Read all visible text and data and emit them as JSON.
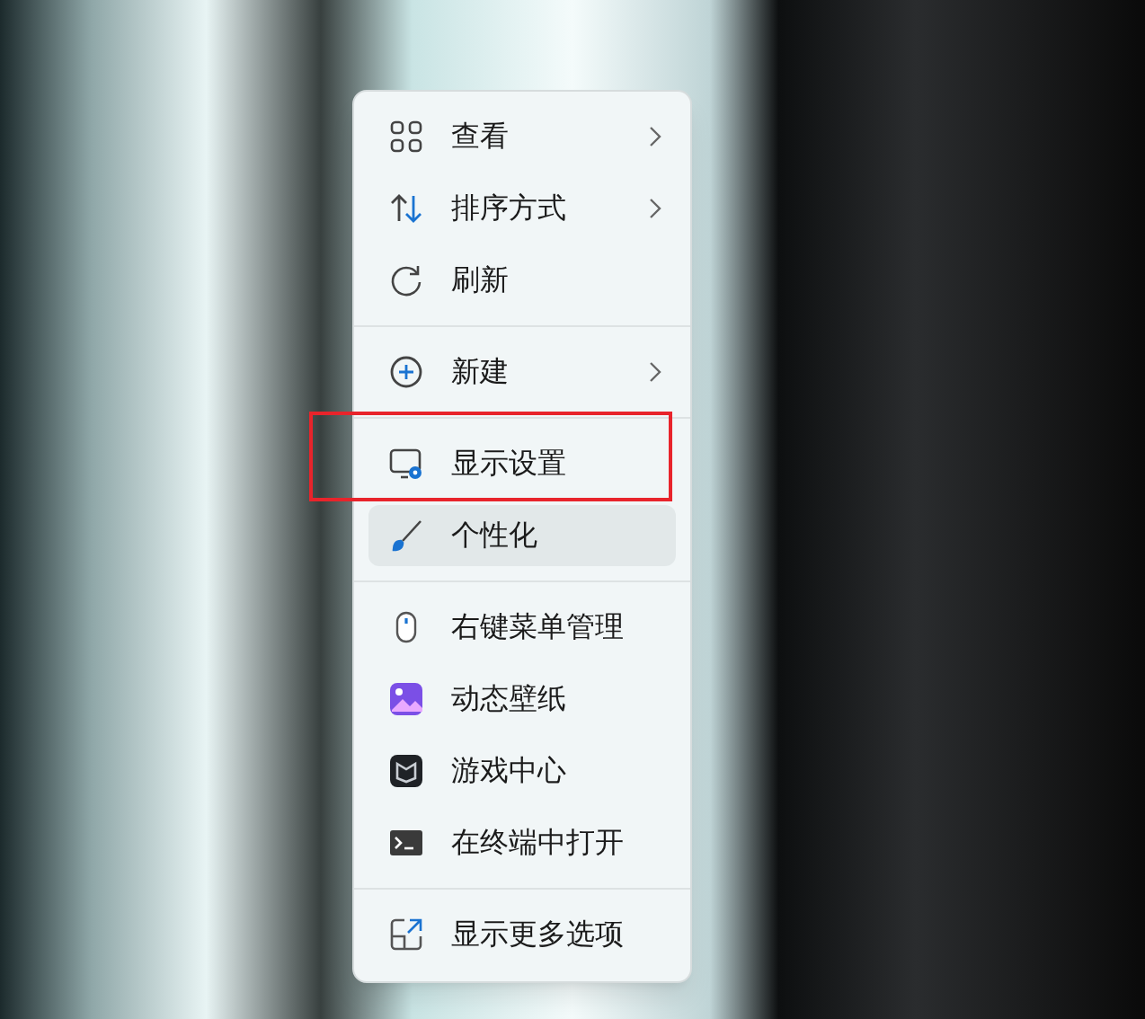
{
  "menu": {
    "sections": [
      {
        "items": [
          {
            "label": "查看",
            "has_submenu": true,
            "selected": false,
            "highlighted": false
          },
          {
            "label": "排序方式",
            "has_submenu": true,
            "selected": false,
            "highlighted": false
          },
          {
            "label": "刷新",
            "has_submenu": false,
            "selected": false,
            "highlighted": false
          }
        ]
      },
      {
        "items": [
          {
            "label": "新建",
            "has_submenu": true,
            "selected": false,
            "highlighted": false
          }
        ]
      },
      {
        "items": [
          {
            "label": "显示设置",
            "has_submenu": false,
            "selected": false,
            "highlighted": true
          },
          {
            "label": "个性化",
            "has_submenu": false,
            "selected": true,
            "highlighted": false
          }
        ]
      },
      {
        "items": [
          {
            "label": "右键菜单管理",
            "has_submenu": false,
            "selected": false,
            "highlighted": false
          },
          {
            "label": "动态壁纸",
            "has_submenu": false,
            "selected": false,
            "highlighted": false
          },
          {
            "label": "游戏中心",
            "has_submenu": false,
            "selected": false,
            "highlighted": false
          },
          {
            "label": "在终端中打开",
            "has_submenu": false,
            "selected": false,
            "highlighted": false
          }
        ]
      },
      {
        "items": [
          {
            "label": "显示更多选项",
            "has_submenu": false,
            "selected": false,
            "highlighted": false
          }
        ]
      }
    ]
  }
}
